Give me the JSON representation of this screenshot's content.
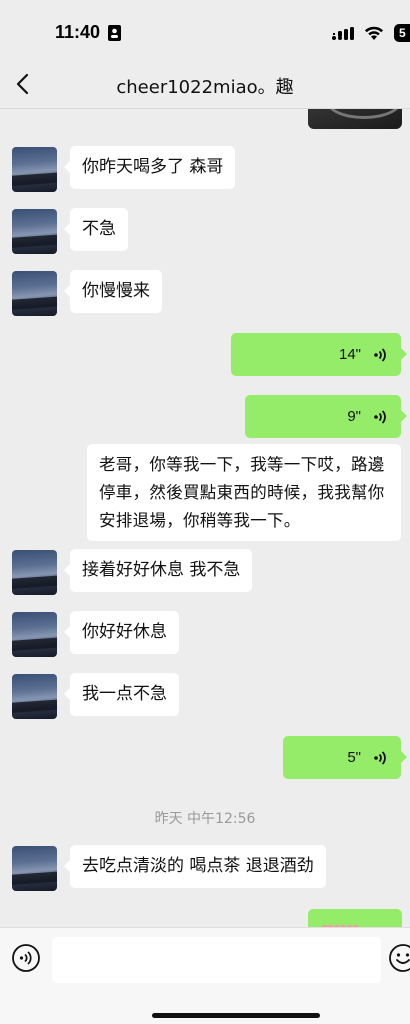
{
  "status_bar": {
    "time": "11:40",
    "battery": "5"
  },
  "header": {
    "title": "cheer1022miao。趣",
    "back_icon": "chevron-left-icon"
  },
  "messages": [
    {
      "direction": "in",
      "type": "text",
      "text": "你昨天喝多了 森哥"
    },
    {
      "direction": "in",
      "type": "text",
      "text": "不急"
    },
    {
      "direction": "in",
      "type": "text",
      "text": "你慢慢来"
    },
    {
      "direction": "out",
      "type": "voice",
      "duration": "14\""
    },
    {
      "direction": "out",
      "type": "voice",
      "duration": "9\"",
      "transcript": "老哥，你等我一下，我等一下哎，路邊停車，然後買點東西的時候，我我幫你安排退場，你稍等我一下。"
    },
    {
      "direction": "in",
      "type": "text",
      "text": "接着好好休息 我不急"
    },
    {
      "direction": "in",
      "type": "text",
      "text": "你好好休息"
    },
    {
      "direction": "in",
      "type": "text",
      "text": "我一点不急"
    },
    {
      "direction": "out",
      "type": "voice",
      "duration": "5\""
    },
    {
      "direction": "in",
      "type": "text",
      "text": "去吃点清淡的 喝点茶 退退酒劲"
    }
  ],
  "timestamp": "昨天 中午12:56",
  "partial_outgoing": "❤❤❤",
  "input_bar": {
    "voice_icon": "voice-input-icon",
    "emoji_icon": "emoji-icon",
    "placeholder": ""
  },
  "colors": {
    "background": "#ededed",
    "outgoing_bubble": "#95ec69",
    "incoming_bubble": "#ffffff",
    "timestamp_text": "#9a9a9a"
  }
}
